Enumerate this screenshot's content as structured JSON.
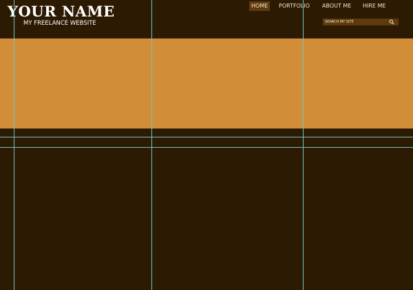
{
  "header": {
    "site_title": "YOUR NAME",
    "site_subtitle": "MY FREELANCE WEBSITE"
  },
  "nav": {
    "items": [
      {
        "label": "HOME",
        "active": true
      },
      {
        "label": "PORTFOLIO",
        "active": false
      },
      {
        "label": "ABOUT ME",
        "active": false
      },
      {
        "label": "HIRE ME",
        "active": false
      }
    ]
  },
  "search": {
    "placeholder": "SEARCH MY SITE",
    "icon": "search-icon"
  },
  "colors": {
    "background": "#2c1a02",
    "banner": "#d18d37",
    "nav_active": "#5f3a0d",
    "guide_lines": "#6ec7bf"
  }
}
